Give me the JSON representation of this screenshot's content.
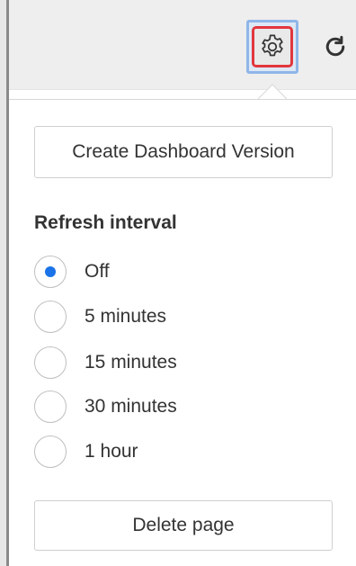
{
  "toolbar": {
    "settings_icon": "gear-icon",
    "refresh_icon": "refresh-icon",
    "highlight_color": "#e2363d",
    "selected_bg": "#dde8f6"
  },
  "popover": {
    "create_version_label": "Create Dashboard Version",
    "refresh_interval": {
      "title": "Refresh interval",
      "selected": "Off",
      "options": [
        {
          "label": "Off",
          "checked": true
        },
        {
          "label": "5 minutes",
          "checked": false
        },
        {
          "label": "15 minutes",
          "checked": false
        },
        {
          "label": "30 minutes",
          "checked": false
        },
        {
          "label": "1 hour",
          "checked": false
        }
      ]
    },
    "delete_label": "Delete page",
    "accent_color": "#1a73e8"
  }
}
